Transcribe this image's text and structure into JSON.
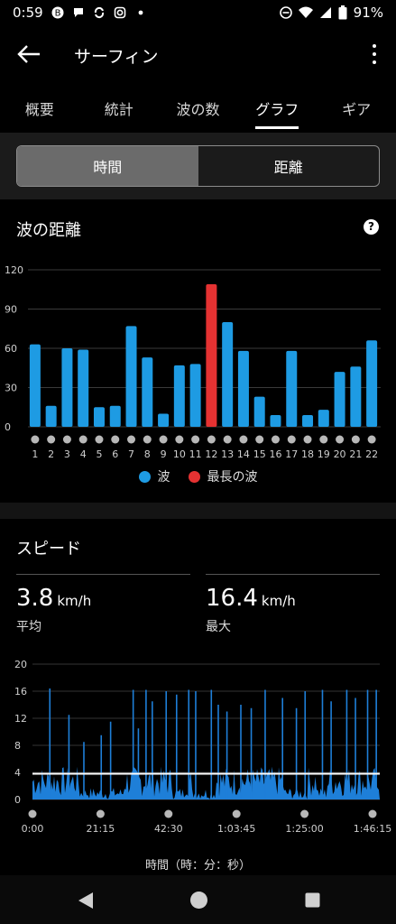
{
  "status": {
    "time": "0:59",
    "battery": "91%",
    "icons": [
      "b-icon",
      "chat-icon",
      "sync-icon",
      "instagram-icon",
      "dot-icon"
    ],
    "right_icons": [
      "dnd-icon",
      "wifi-icon",
      "signal-icon",
      "battery-icon"
    ]
  },
  "header": {
    "title": "サーフィン"
  },
  "tabs": [
    {
      "label": "概要"
    },
    {
      "label": "統計"
    },
    {
      "label": "波の数"
    },
    {
      "label": "グラフ"
    },
    {
      "label": "ギア"
    }
  ],
  "toggle": {
    "time": "時間",
    "distance": "距離"
  },
  "wave_section": {
    "title": "波の距離",
    "legend": {
      "wave": "波",
      "longest": "最長の波"
    }
  },
  "colors": {
    "wave": "#1e9be3",
    "longest": "#e53232",
    "speed": "#1e7fd8",
    "dot": "#b8b8b8"
  },
  "chart_data": [
    {
      "type": "bar",
      "title": "波の距離",
      "categories": [
        "1",
        "2",
        "3",
        "4",
        "5",
        "6",
        "7",
        "8",
        "9",
        "10",
        "11",
        "12",
        "13",
        "14",
        "15",
        "16",
        "17",
        "18",
        "19",
        "20",
        "21",
        "22"
      ],
      "series": [
        {
          "name": "波",
          "values": [
            63,
            16,
            60,
            59,
            15,
            16,
            77,
            53,
            10,
            47,
            48,
            109,
            80,
            58,
            23,
            9,
            58,
            9,
            13,
            42,
            46,
            66
          ]
        }
      ],
      "highlight_index": 11,
      "ylim": [
        0,
        120
      ],
      "yticks": [
        0,
        30,
        60,
        90,
        120
      ],
      "grid": true
    },
    {
      "type": "area",
      "title": "スピード",
      "xlabel": "時間（時：分：秒）",
      "xticks": [
        "0:00",
        "21:15",
        "42:30",
        "1:03:45",
        "1:25:00",
        "1:46:15"
      ],
      "ylim": [
        0,
        20
      ],
      "yticks": [
        0,
        4,
        8,
        12,
        16,
        20
      ],
      "average": 3.8,
      "max": 16.4,
      "spikes": [
        {
          "t": 0.05,
          "v": 16.4
        },
        {
          "t": 0.105,
          "v": 12.5
        },
        {
          "t": 0.148,
          "v": 8.5
        },
        {
          "t": 0.198,
          "v": 9.5
        },
        {
          "t": 0.225,
          "v": 11.5
        },
        {
          "t": 0.29,
          "v": 16.2
        },
        {
          "t": 0.305,
          "v": 10.5
        },
        {
          "t": 0.327,
          "v": 16.2
        },
        {
          "t": 0.345,
          "v": 14.5
        },
        {
          "t": 0.385,
          "v": 16.0
        },
        {
          "t": 0.415,
          "v": 15.5
        },
        {
          "t": 0.45,
          "v": 16.2
        },
        {
          "t": 0.47,
          "v": 16.0
        },
        {
          "t": 0.515,
          "v": 16.2
        },
        {
          "t": 0.535,
          "v": 14.0
        },
        {
          "t": 0.56,
          "v": 13.0
        },
        {
          "t": 0.6,
          "v": 14.0
        },
        {
          "t": 0.63,
          "v": 13.5
        },
        {
          "t": 0.67,
          "v": 16.2
        },
        {
          "t": 0.72,
          "v": 15.0
        },
        {
          "t": 0.76,
          "v": 13.5
        },
        {
          "t": 0.785,
          "v": 16.0
        },
        {
          "t": 0.835,
          "v": 16.2
        },
        {
          "t": 0.86,
          "v": 14.5
        },
        {
          "t": 0.905,
          "v": 16.2
        },
        {
          "t": 0.93,
          "v": 15.0
        },
        {
          "t": 0.965,
          "v": 16.2
        },
        {
          "t": 0.99,
          "v": 16.2
        }
      ]
    }
  ],
  "speed_section": {
    "title": "スピード",
    "avg_value": "3.8",
    "avg_unit": "km/h",
    "avg_label": "平均",
    "max_value": "16.4",
    "max_unit": "km/h",
    "max_label": "最大",
    "xlabel": "時間（時：分：秒）"
  }
}
